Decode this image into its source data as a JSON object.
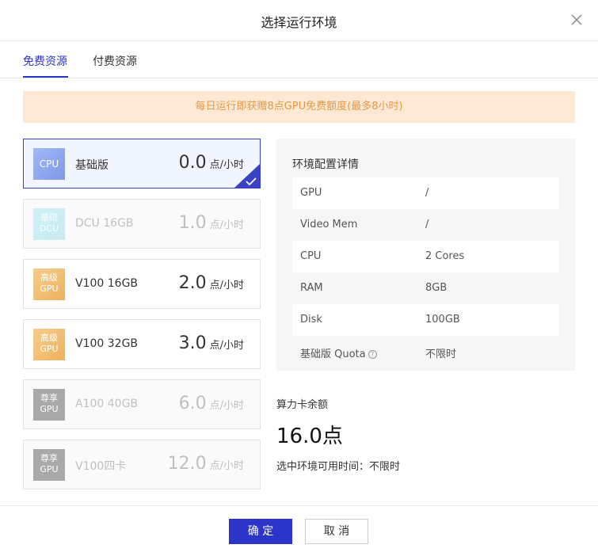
{
  "dialog": {
    "title": "选择运行环境"
  },
  "tabs": [
    {
      "label": "免费资源"
    },
    {
      "label": "付费资源"
    }
  ],
  "notice": "每日运行即获赠8点GPU免费额度(最多8小时)",
  "cards": [
    {
      "badge": "CPU",
      "name": "基础版",
      "price": "0.0",
      "unit": "点/小时"
    },
    {
      "badge": "基础\nDCU",
      "name": "DCU 16GB",
      "price": "1.0",
      "unit": "点/小时"
    },
    {
      "badge": "高级\nGPU",
      "name": "V100 16GB",
      "price": "2.0",
      "unit": "点/小时"
    },
    {
      "badge": "高级\nGPU",
      "name": "V100 32GB",
      "price": "3.0",
      "unit": "点/小时"
    },
    {
      "badge": "尊享\nGPU",
      "name": "A100 40GB",
      "price": "6.0",
      "unit": "点/小时"
    },
    {
      "badge": "尊享\nGPU",
      "name": "V100四卡",
      "price": "12.0",
      "unit": "点/小时"
    }
  ],
  "detail": {
    "title": "环境配置详情",
    "rows": [
      {
        "key": "GPU",
        "value": "/"
      },
      {
        "key": "Video Mem",
        "value": "/"
      },
      {
        "key": "CPU",
        "value": "2 Cores"
      },
      {
        "key": "RAM",
        "value": "8GB"
      },
      {
        "key": "Disk",
        "value": "100GB"
      },
      {
        "key": "基础版 Quota",
        "value": "不限时"
      }
    ]
  },
  "balance": {
    "label": "算力卡余额",
    "value": "16.0点"
  },
  "availability": "选中环境可用时间：不限时",
  "buttons": {
    "confirm": "确 定",
    "cancel": "取 消"
  },
  "colors": {
    "accent": "#2b35c9",
    "notice_bg": "#fde8d3",
    "notice_text": "#e29a49"
  }
}
